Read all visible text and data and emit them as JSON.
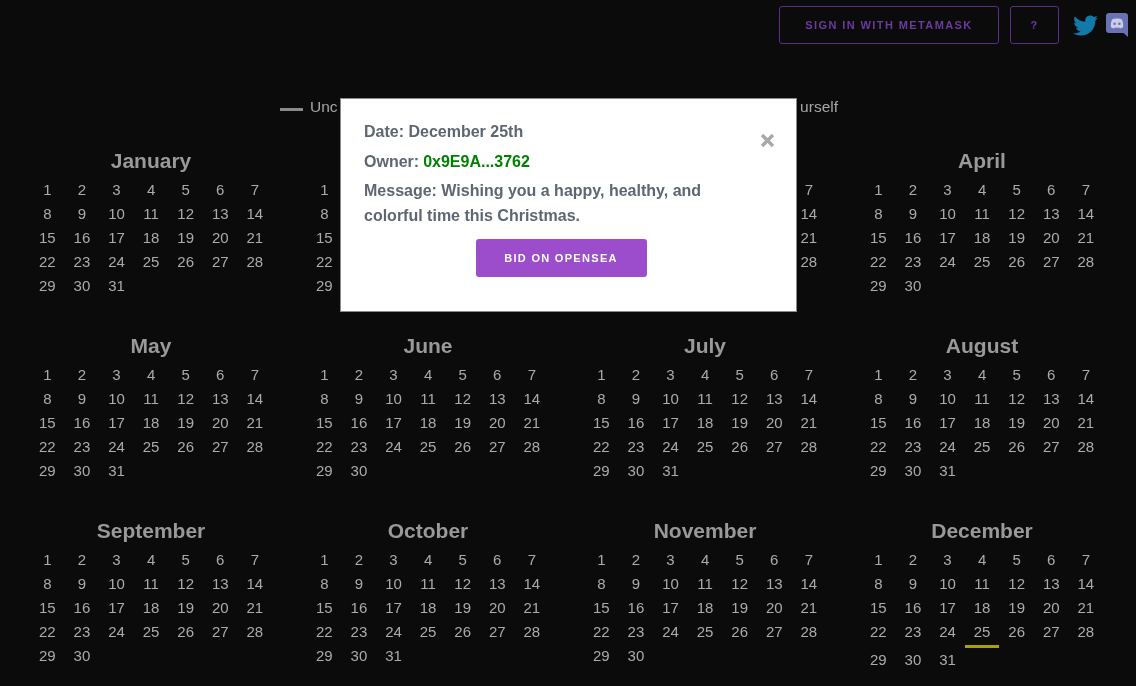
{
  "header": {
    "sign_in_button": "SIGN IN WITH METAMASK",
    "help_button": "?"
  },
  "legend": {
    "start_label": "Unc",
    "end_label": "urself"
  },
  "calendar": {
    "months": [
      {
        "name": "January",
        "days": [
          {
            "label": "1",
            "selected": false
          },
          {
            "label": "2",
            "selected": false
          },
          {
            "label": "3",
            "selected": false
          },
          {
            "label": "4",
            "selected": false
          },
          {
            "label": "5",
            "selected": false
          },
          {
            "label": "6",
            "selected": false
          },
          {
            "label": "7",
            "selected": false
          },
          {
            "label": "8",
            "selected": false
          },
          {
            "label": "9",
            "selected": false
          },
          {
            "label": "10",
            "selected": false
          },
          {
            "label": "11",
            "selected": false
          },
          {
            "label": "12",
            "selected": false
          },
          {
            "label": "13",
            "selected": false
          },
          {
            "label": "14",
            "selected": false
          },
          {
            "label": "15",
            "selected": false
          },
          {
            "label": "16",
            "selected": false
          },
          {
            "label": "17",
            "selected": false
          },
          {
            "label": "18",
            "selected": false
          },
          {
            "label": "19",
            "selected": false
          },
          {
            "label": "20",
            "selected": false
          },
          {
            "label": "21",
            "selected": false
          },
          {
            "label": "22",
            "selected": false
          },
          {
            "label": "23",
            "selected": false
          },
          {
            "label": "24",
            "selected": false
          },
          {
            "label": "25",
            "selected": false
          },
          {
            "label": "26",
            "selected": false
          },
          {
            "label": "27",
            "selected": false
          },
          {
            "label": "28",
            "selected": false
          },
          {
            "label": "29",
            "selected": false
          },
          {
            "label": "30",
            "selected": false
          },
          {
            "label": "31",
            "selected": false
          }
        ]
      },
      {
        "days": [
          {
            "label": "1",
            "selected": false
          },
          {
            "label": "8",
            "selected": false
          },
          {
            "label": "15",
            "selected": false
          },
          {
            "label": "22",
            "selected": false
          },
          {
            "label": "29",
            "selected": false
          }
        ]
      },
      {
        "days": [
          {
            "label": "7",
            "selected": false
          },
          {
            "label": "14",
            "selected": false
          },
          {
            "label": "21",
            "selected": false
          },
          {
            "label": "28",
            "selected": false
          }
        ]
      },
      {
        "name": "April",
        "days": [
          {
            "label": "1",
            "selected": false
          },
          {
            "label": "2",
            "selected": false
          },
          {
            "label": "3",
            "selected": false
          },
          {
            "label": "4",
            "selected": false
          },
          {
            "label": "5",
            "selected": false
          },
          {
            "label": "6",
            "selected": false
          },
          {
            "label": "7",
            "selected": false
          },
          {
            "label": "8",
            "selected": false
          },
          {
            "label": "9",
            "selected": false
          },
          {
            "label": "10",
            "selected": false
          },
          {
            "label": "11",
            "selected": false
          },
          {
            "label": "12",
            "selected": false
          },
          {
            "label": "13",
            "selected": false
          },
          {
            "label": "14",
            "selected": false
          },
          {
            "label": "15",
            "selected": false
          },
          {
            "label": "16",
            "selected": false
          },
          {
            "label": "17",
            "selected": false
          },
          {
            "label": "18",
            "selected": false
          },
          {
            "label": "19",
            "selected": false
          },
          {
            "label": "20",
            "selected": false
          },
          {
            "label": "21",
            "selected": false
          },
          {
            "label": "22",
            "selected": false
          },
          {
            "label": "23",
            "selected": false
          },
          {
            "label": "24",
            "selected": false
          },
          {
            "label": "25",
            "selected": false
          },
          {
            "label": "26",
            "selected": false
          },
          {
            "label": "27",
            "selected": false
          },
          {
            "label": "28",
            "selected": false
          },
          {
            "label": "29",
            "selected": false
          },
          {
            "label": "30",
            "selected": false
          }
        ]
      },
      {
        "name": "May",
        "days": [
          {
            "label": "1",
            "selected": false
          },
          {
            "label": "2",
            "selected": false
          },
          {
            "label": "3",
            "selected": false
          },
          {
            "label": "4",
            "selected": false
          },
          {
            "label": "5",
            "selected": false
          },
          {
            "label": "6",
            "selected": false
          },
          {
            "label": "7",
            "selected": false
          },
          {
            "label": "8",
            "selected": false
          },
          {
            "label": "9",
            "selected": false
          },
          {
            "label": "10",
            "selected": false
          },
          {
            "label": "11",
            "selected": false
          },
          {
            "label": "12",
            "selected": false
          },
          {
            "label": "13",
            "selected": false
          },
          {
            "label": "14",
            "selected": false
          },
          {
            "label": "15",
            "selected": false
          },
          {
            "label": "16",
            "selected": false
          },
          {
            "label": "17",
            "selected": false
          },
          {
            "label": "18",
            "selected": false
          },
          {
            "label": "19",
            "selected": false
          },
          {
            "label": "20",
            "selected": false
          },
          {
            "label": "21",
            "selected": false
          },
          {
            "label": "22",
            "selected": false
          },
          {
            "label": "23",
            "selected": false
          },
          {
            "label": "24",
            "selected": false
          },
          {
            "label": "25",
            "selected": false
          },
          {
            "label": "26",
            "selected": false
          },
          {
            "label": "27",
            "selected": false
          },
          {
            "label": "28",
            "selected": false
          },
          {
            "label": "29",
            "selected": false
          },
          {
            "label": "30",
            "selected": false
          },
          {
            "label": "31",
            "selected": false
          }
        ]
      },
      {
        "name": "June",
        "days": [
          {
            "label": "1",
            "selected": false
          },
          {
            "label": "2",
            "selected": false
          },
          {
            "label": "3",
            "selected": false
          },
          {
            "label": "4",
            "selected": false
          },
          {
            "label": "5",
            "selected": false
          },
          {
            "label": "6",
            "selected": false
          },
          {
            "label": "7",
            "selected": false
          },
          {
            "label": "8",
            "selected": false
          },
          {
            "label": "9",
            "selected": false
          },
          {
            "label": "10",
            "selected": false
          },
          {
            "label": "11",
            "selected": false
          },
          {
            "label": "12",
            "selected": false
          },
          {
            "label": "13",
            "selected": false
          },
          {
            "label": "14",
            "selected": false
          },
          {
            "label": "15",
            "selected": false
          },
          {
            "label": "16",
            "selected": false
          },
          {
            "label": "17",
            "selected": false
          },
          {
            "label": "18",
            "selected": false
          },
          {
            "label": "19",
            "selected": false
          },
          {
            "label": "20",
            "selected": false
          },
          {
            "label": "21",
            "selected": false
          },
          {
            "label": "22",
            "selected": false
          },
          {
            "label": "23",
            "selected": false
          },
          {
            "label": "24",
            "selected": false
          },
          {
            "label": "25",
            "selected": false
          },
          {
            "label": "26",
            "selected": false
          },
          {
            "label": "27",
            "selected": false
          },
          {
            "label": "28",
            "selected": false
          },
          {
            "label": "29",
            "selected": false
          },
          {
            "label": "30",
            "selected": false
          }
        ]
      },
      {
        "name": "July",
        "days": [
          {
            "label": "1",
            "selected": false
          },
          {
            "label": "2",
            "selected": false
          },
          {
            "label": "3",
            "selected": false
          },
          {
            "label": "4",
            "selected": false
          },
          {
            "label": "5",
            "selected": false
          },
          {
            "label": "6",
            "selected": false
          },
          {
            "label": "7",
            "selected": false
          },
          {
            "label": "8",
            "selected": false
          },
          {
            "label": "9",
            "selected": false
          },
          {
            "label": "10",
            "selected": false
          },
          {
            "label": "11",
            "selected": false
          },
          {
            "label": "12",
            "selected": false
          },
          {
            "label": "13",
            "selected": false
          },
          {
            "label": "14",
            "selected": false
          },
          {
            "label": "15",
            "selected": false
          },
          {
            "label": "16",
            "selected": false
          },
          {
            "label": "17",
            "selected": false
          },
          {
            "label": "18",
            "selected": false
          },
          {
            "label": "19",
            "selected": false
          },
          {
            "label": "20",
            "selected": false
          },
          {
            "label": "21",
            "selected": false
          },
          {
            "label": "22",
            "selected": false
          },
          {
            "label": "23",
            "selected": false
          },
          {
            "label": "24",
            "selected": false
          },
          {
            "label": "25",
            "selected": false
          },
          {
            "label": "26",
            "selected": false
          },
          {
            "label": "27",
            "selected": false
          },
          {
            "label": "28",
            "selected": false
          },
          {
            "label": "29",
            "selected": false
          },
          {
            "label": "30",
            "selected": false
          },
          {
            "label": "31",
            "selected": false
          }
        ]
      },
      {
        "name": "August",
        "days": [
          {
            "label": "1",
            "selected": false
          },
          {
            "label": "2",
            "selected": false
          },
          {
            "label": "3",
            "selected": false
          },
          {
            "label": "4",
            "selected": false
          },
          {
            "label": "5",
            "selected": false
          },
          {
            "label": "6",
            "selected": false
          },
          {
            "label": "7",
            "selected": false
          },
          {
            "label": "8",
            "selected": false
          },
          {
            "label": "9",
            "selected": false
          },
          {
            "label": "10",
            "selected": false
          },
          {
            "label": "11",
            "selected": false
          },
          {
            "label": "12",
            "selected": false
          },
          {
            "label": "13",
            "selected": false
          },
          {
            "label": "14",
            "selected": false
          },
          {
            "label": "15",
            "selected": false
          },
          {
            "label": "16",
            "selected": false
          },
          {
            "label": "17",
            "selected": false
          },
          {
            "label": "18",
            "selected": false
          },
          {
            "label": "19",
            "selected": false
          },
          {
            "label": "20",
            "selected": false
          },
          {
            "label": "21",
            "selected": false
          },
          {
            "label": "22",
            "selected": false
          },
          {
            "label": "23",
            "selected": false
          },
          {
            "label": "24",
            "selected": false
          },
          {
            "label": "25",
            "selected": false
          },
          {
            "label": "26",
            "selected": false
          },
          {
            "label": "27",
            "selected": false
          },
          {
            "label": "28",
            "selected": false
          },
          {
            "label": "29",
            "selected": false
          },
          {
            "label": "30",
            "selected": false
          },
          {
            "label": "31",
            "selected": false
          }
        ]
      },
      {
        "name": "September",
        "days": [
          {
            "label": "1",
            "selected": false
          },
          {
            "label": "2",
            "selected": false
          },
          {
            "label": "3",
            "selected": false
          },
          {
            "label": "4",
            "selected": false
          },
          {
            "label": "5",
            "selected": false
          },
          {
            "label": "6",
            "selected": false
          },
          {
            "label": "7",
            "selected": false
          },
          {
            "label": "8",
            "selected": false
          },
          {
            "label": "9",
            "selected": false
          },
          {
            "label": "10",
            "selected": false
          },
          {
            "label": "11",
            "selected": false
          },
          {
            "label": "12",
            "selected": false
          },
          {
            "label": "13",
            "selected": false
          },
          {
            "label": "14",
            "selected": false
          },
          {
            "label": "15",
            "selected": false
          },
          {
            "label": "16",
            "selected": false
          },
          {
            "label": "17",
            "selected": false
          },
          {
            "label": "18",
            "selected": false
          },
          {
            "label": "19",
            "selected": false
          },
          {
            "label": "20",
            "selected": false
          },
          {
            "label": "21",
            "selected": false
          },
          {
            "label": "22",
            "selected": false
          },
          {
            "label": "23",
            "selected": false
          },
          {
            "label": "24",
            "selected": false
          },
          {
            "label": "25",
            "selected": false
          },
          {
            "label": "26",
            "selected": false
          },
          {
            "label": "27",
            "selected": false
          },
          {
            "label": "28",
            "selected": false
          },
          {
            "label": "29",
            "selected": false
          },
          {
            "label": "30",
            "selected": false
          }
        ]
      },
      {
        "name": "October",
        "days": [
          {
            "label": "1",
            "selected": false
          },
          {
            "label": "2",
            "selected": false
          },
          {
            "label": "3",
            "selected": false
          },
          {
            "label": "4",
            "selected": false
          },
          {
            "label": "5",
            "selected": false
          },
          {
            "label": "6",
            "selected": false
          },
          {
            "label": "7",
            "selected": false
          },
          {
            "label": "8",
            "selected": false
          },
          {
            "label": "9",
            "selected": false
          },
          {
            "label": "10",
            "selected": false
          },
          {
            "label": "11",
            "selected": false
          },
          {
            "label": "12",
            "selected": false
          },
          {
            "label": "13",
            "selected": false
          },
          {
            "label": "14",
            "selected": false
          },
          {
            "label": "15",
            "selected": false
          },
          {
            "label": "16",
            "selected": false
          },
          {
            "label": "17",
            "selected": false
          },
          {
            "label": "18",
            "selected": false
          },
          {
            "label": "19",
            "selected": false
          },
          {
            "label": "20",
            "selected": false
          },
          {
            "label": "21",
            "selected": false
          },
          {
            "label": "22",
            "selected": false
          },
          {
            "label": "23",
            "selected": false
          },
          {
            "label": "24",
            "selected": false
          },
          {
            "label": "25",
            "selected": false
          },
          {
            "label": "26",
            "selected": false
          },
          {
            "label": "27",
            "selected": false
          },
          {
            "label": "28",
            "selected": false
          },
          {
            "label": "29",
            "selected": false
          },
          {
            "label": "30",
            "selected": false
          },
          {
            "label": "31",
            "selected": false
          }
        ]
      },
      {
        "name": "November",
        "days": [
          {
            "label": "1",
            "selected": false
          },
          {
            "label": "2",
            "selected": false
          },
          {
            "label": "3",
            "selected": false
          },
          {
            "label": "4",
            "selected": false
          },
          {
            "label": "5",
            "selected": false
          },
          {
            "label": "6",
            "selected": false
          },
          {
            "label": "7",
            "selected": false
          },
          {
            "label": "8",
            "selected": false
          },
          {
            "label": "9",
            "selected": false
          },
          {
            "label": "10",
            "selected": false
          },
          {
            "label": "11",
            "selected": false
          },
          {
            "label": "12",
            "selected": false
          },
          {
            "label": "13",
            "selected": false
          },
          {
            "label": "14",
            "selected": false
          },
          {
            "label": "15",
            "selected": false
          },
          {
            "label": "16",
            "selected": false
          },
          {
            "label": "17",
            "selected": false
          },
          {
            "label": "18",
            "selected": false
          },
          {
            "label": "19",
            "selected": false
          },
          {
            "label": "20",
            "selected": false
          },
          {
            "label": "21",
            "selected": false
          },
          {
            "label": "22",
            "selected": false
          },
          {
            "label": "23",
            "selected": false
          },
          {
            "label": "24",
            "selected": false
          },
          {
            "label": "25",
            "selected": false
          },
          {
            "label": "26",
            "selected": false
          },
          {
            "label": "27",
            "selected": false
          },
          {
            "label": "28",
            "selected": false
          },
          {
            "label": "29",
            "selected": false
          },
          {
            "label": "30",
            "selected": false
          }
        ]
      },
      {
        "name": "December",
        "days": [
          {
            "label": "1",
            "selected": false
          },
          {
            "label": "2",
            "selected": false
          },
          {
            "label": "3",
            "selected": false
          },
          {
            "label": "4",
            "selected": false
          },
          {
            "label": "5",
            "selected": false
          },
          {
            "label": "6",
            "selected": false
          },
          {
            "label": "7",
            "selected": false
          },
          {
            "label": "8",
            "selected": false
          },
          {
            "label": "9",
            "selected": false
          },
          {
            "label": "10",
            "selected": false
          },
          {
            "label": "11",
            "selected": false
          },
          {
            "label": "12",
            "selected": false
          },
          {
            "label": "13",
            "selected": false
          },
          {
            "label": "14",
            "selected": false
          },
          {
            "label": "15",
            "selected": false
          },
          {
            "label": "16",
            "selected": false
          },
          {
            "label": "17",
            "selected": false
          },
          {
            "label": "18",
            "selected": false
          },
          {
            "label": "19",
            "selected": false
          },
          {
            "label": "20",
            "selected": false
          },
          {
            "label": "21",
            "selected": false
          },
          {
            "label": "22",
            "selected": false
          },
          {
            "label": "23",
            "selected": false
          },
          {
            "label": "24",
            "selected": false
          },
          {
            "label": "25",
            "selected": true
          },
          {
            "label": "26",
            "selected": false
          },
          {
            "label": "27",
            "selected": false
          },
          {
            "label": "28",
            "selected": false
          },
          {
            "label": "29",
            "selected": false
          },
          {
            "label": "30",
            "selected": false
          },
          {
            "label": "31",
            "selected": false
          }
        ]
      }
    ]
  },
  "modal": {
    "date": "Date: December 25th",
    "owner_label": "Owner:",
    "owner": "0x9E9A...3762",
    "message": "Message: Wishing you a happy, healthy, and colorful time this Christmas.",
    "bid_button": "BID ON OPENSEA"
  }
}
